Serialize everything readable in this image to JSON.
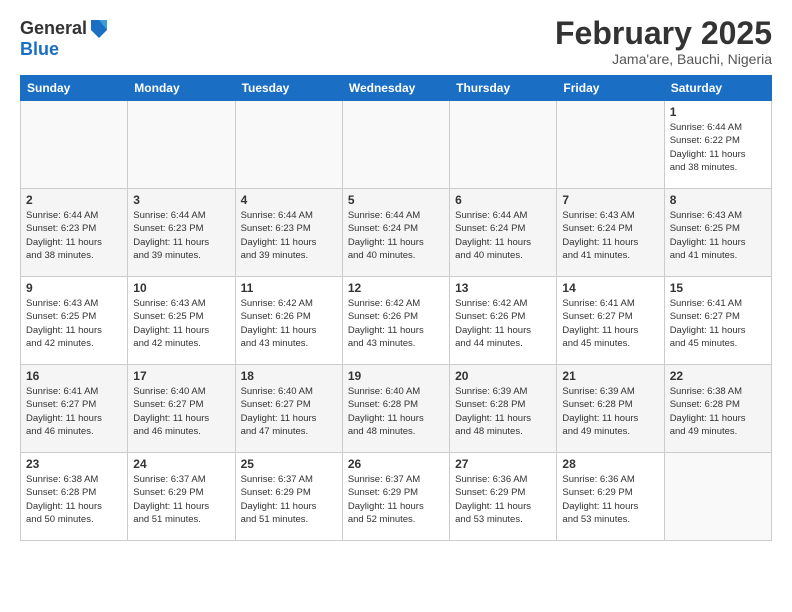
{
  "header": {
    "logo_general": "General",
    "logo_blue": "Blue",
    "month_title": "February 2025",
    "subtitle": "Jama'are, Bauchi, Nigeria"
  },
  "days_of_week": [
    "Sunday",
    "Monday",
    "Tuesday",
    "Wednesday",
    "Thursday",
    "Friday",
    "Saturday"
  ],
  "weeks": [
    [
      {
        "day": "",
        "info": ""
      },
      {
        "day": "",
        "info": ""
      },
      {
        "day": "",
        "info": ""
      },
      {
        "day": "",
        "info": ""
      },
      {
        "day": "",
        "info": ""
      },
      {
        "day": "",
        "info": ""
      },
      {
        "day": "1",
        "info": "Sunrise: 6:44 AM\nSunset: 6:22 PM\nDaylight: 11 hours\nand 38 minutes."
      }
    ],
    [
      {
        "day": "2",
        "info": "Sunrise: 6:44 AM\nSunset: 6:23 PM\nDaylight: 11 hours\nand 38 minutes."
      },
      {
        "day": "3",
        "info": "Sunrise: 6:44 AM\nSunset: 6:23 PM\nDaylight: 11 hours\nand 39 minutes."
      },
      {
        "day": "4",
        "info": "Sunrise: 6:44 AM\nSunset: 6:23 PM\nDaylight: 11 hours\nand 39 minutes."
      },
      {
        "day": "5",
        "info": "Sunrise: 6:44 AM\nSunset: 6:24 PM\nDaylight: 11 hours\nand 40 minutes."
      },
      {
        "day": "6",
        "info": "Sunrise: 6:44 AM\nSunset: 6:24 PM\nDaylight: 11 hours\nand 40 minutes."
      },
      {
        "day": "7",
        "info": "Sunrise: 6:43 AM\nSunset: 6:24 PM\nDaylight: 11 hours\nand 41 minutes."
      },
      {
        "day": "8",
        "info": "Sunrise: 6:43 AM\nSunset: 6:25 PM\nDaylight: 11 hours\nand 41 minutes."
      }
    ],
    [
      {
        "day": "9",
        "info": "Sunrise: 6:43 AM\nSunset: 6:25 PM\nDaylight: 11 hours\nand 42 minutes."
      },
      {
        "day": "10",
        "info": "Sunrise: 6:43 AM\nSunset: 6:25 PM\nDaylight: 11 hours\nand 42 minutes."
      },
      {
        "day": "11",
        "info": "Sunrise: 6:42 AM\nSunset: 6:26 PM\nDaylight: 11 hours\nand 43 minutes."
      },
      {
        "day": "12",
        "info": "Sunrise: 6:42 AM\nSunset: 6:26 PM\nDaylight: 11 hours\nand 43 minutes."
      },
      {
        "day": "13",
        "info": "Sunrise: 6:42 AM\nSunset: 6:26 PM\nDaylight: 11 hours\nand 44 minutes."
      },
      {
        "day": "14",
        "info": "Sunrise: 6:41 AM\nSunset: 6:27 PM\nDaylight: 11 hours\nand 45 minutes."
      },
      {
        "day": "15",
        "info": "Sunrise: 6:41 AM\nSunset: 6:27 PM\nDaylight: 11 hours\nand 45 minutes."
      }
    ],
    [
      {
        "day": "16",
        "info": "Sunrise: 6:41 AM\nSunset: 6:27 PM\nDaylight: 11 hours\nand 46 minutes."
      },
      {
        "day": "17",
        "info": "Sunrise: 6:40 AM\nSunset: 6:27 PM\nDaylight: 11 hours\nand 46 minutes."
      },
      {
        "day": "18",
        "info": "Sunrise: 6:40 AM\nSunset: 6:27 PM\nDaylight: 11 hours\nand 47 minutes."
      },
      {
        "day": "19",
        "info": "Sunrise: 6:40 AM\nSunset: 6:28 PM\nDaylight: 11 hours\nand 48 minutes."
      },
      {
        "day": "20",
        "info": "Sunrise: 6:39 AM\nSunset: 6:28 PM\nDaylight: 11 hours\nand 48 minutes."
      },
      {
        "day": "21",
        "info": "Sunrise: 6:39 AM\nSunset: 6:28 PM\nDaylight: 11 hours\nand 49 minutes."
      },
      {
        "day": "22",
        "info": "Sunrise: 6:38 AM\nSunset: 6:28 PM\nDaylight: 11 hours\nand 49 minutes."
      }
    ],
    [
      {
        "day": "23",
        "info": "Sunrise: 6:38 AM\nSunset: 6:28 PM\nDaylight: 11 hours\nand 50 minutes."
      },
      {
        "day": "24",
        "info": "Sunrise: 6:37 AM\nSunset: 6:29 PM\nDaylight: 11 hours\nand 51 minutes."
      },
      {
        "day": "25",
        "info": "Sunrise: 6:37 AM\nSunset: 6:29 PM\nDaylight: 11 hours\nand 51 minutes."
      },
      {
        "day": "26",
        "info": "Sunrise: 6:37 AM\nSunset: 6:29 PM\nDaylight: 11 hours\nand 52 minutes."
      },
      {
        "day": "27",
        "info": "Sunrise: 6:36 AM\nSunset: 6:29 PM\nDaylight: 11 hours\nand 53 minutes."
      },
      {
        "day": "28",
        "info": "Sunrise: 6:36 AM\nSunset: 6:29 PM\nDaylight: 11 hours\nand 53 minutes."
      },
      {
        "day": "",
        "info": ""
      }
    ]
  ]
}
